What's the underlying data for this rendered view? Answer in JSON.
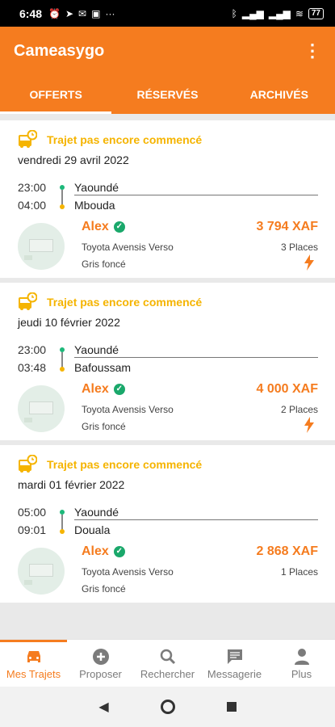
{
  "statusbar": {
    "time": "6:48",
    "battery": "77"
  },
  "appbar": {
    "title": "Cameasygo",
    "menu_glyph": "⋮"
  },
  "tabs": [
    {
      "label": "OFFERTS",
      "active": true
    },
    {
      "label": "RÉSERVÉS",
      "active": false
    },
    {
      "label": "ARCHIVÉS",
      "active": false
    }
  ],
  "trips": [
    {
      "status": "Trajet pas encore commencé",
      "date": "vendredi 29 avril 2022",
      "depart_time": "23:00",
      "arrive_time": "04:00",
      "from": "Yaoundé",
      "to": "Mbouda",
      "driver": "Alex",
      "car": "Toyota Avensis Verso",
      "color": "Gris foncé",
      "price": "3 794 XAF",
      "places": "3 Places",
      "instant": true
    },
    {
      "status": "Trajet pas encore commencé",
      "date": "jeudi 10 février 2022",
      "depart_time": "23:00",
      "arrive_time": "03:48",
      "from": "Yaoundé",
      "to": "Bafoussam",
      "driver": "Alex",
      "car": "Toyota Avensis Verso",
      "color": "Gris foncé",
      "price": "4 000 XAF",
      "places": "2 Places",
      "instant": true
    },
    {
      "status": "Trajet pas encore commencé",
      "date": "mardi 01 février 2022",
      "depart_time": "05:00",
      "arrive_time": "09:01",
      "from": "Yaoundé",
      "to": "Douala",
      "driver": "Alex",
      "car": "Toyota Avensis Verso",
      "color": "Gris foncé",
      "price": "2 868 XAF",
      "places": "1 Places",
      "instant": false
    }
  ],
  "bottom_nav": [
    {
      "label": "Mes Trajets",
      "icon": "car-icon",
      "active": true
    },
    {
      "label": "Proposer",
      "icon": "plus-circle-icon",
      "active": false
    },
    {
      "label": "Rechercher",
      "icon": "search-icon",
      "active": false
    },
    {
      "label": "Messagerie",
      "icon": "chat-icon",
      "active": false
    },
    {
      "label": "Plus",
      "icon": "person-icon",
      "active": false
    }
  ],
  "colors": {
    "accent": "#f57c1f",
    "status": "#f5b400",
    "verified": "#1aa86b"
  }
}
